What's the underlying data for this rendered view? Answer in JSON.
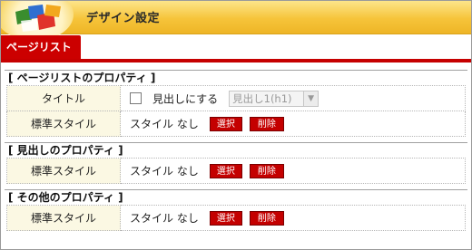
{
  "header": {
    "title": "デザイン設定",
    "logo_icon": "color-blocks-icon"
  },
  "tabs": [
    {
      "label": "ページリスト",
      "active": true
    }
  ],
  "sections": [
    {
      "title": "[ ページリストのプロパティ ]",
      "title_row": {
        "label": "タイトル",
        "checkbox_label": "見出しにする",
        "checked": false,
        "select_value": "見出し1(h1)",
        "select_disabled": true
      },
      "style_row": {
        "label": "標準スタイル",
        "value": "スタイル なし",
        "select_button": "選択",
        "delete_button": "削除"
      }
    },
    {
      "title": "[ 見出しのプロパティ ]",
      "style_row": {
        "label": "標準スタイル",
        "value": "スタイル なし",
        "select_button": "選択",
        "delete_button": "削除"
      }
    },
    {
      "title": "[ その他のプロパティ ]",
      "style_row": {
        "label": "標準スタイル",
        "value": "スタイル なし",
        "select_button": "選択",
        "delete_button": "削除"
      }
    }
  ],
  "colors": {
    "header_bg": "#f6c43a",
    "tab_bg": "#cc0000",
    "button_bg": "#c40000",
    "label_bg": "#fbf8e3"
  }
}
